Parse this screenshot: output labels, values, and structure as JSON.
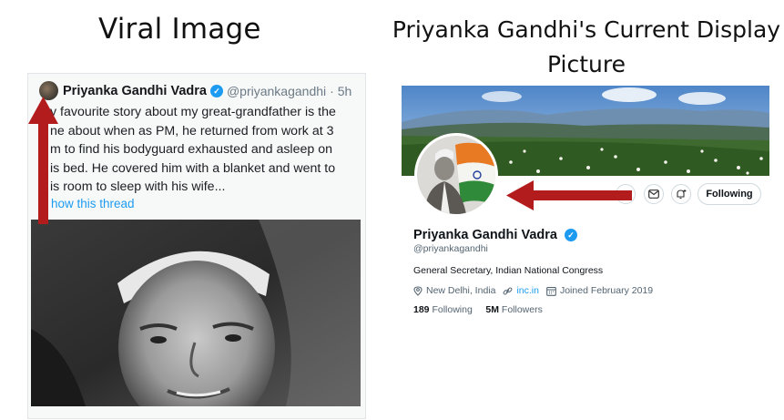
{
  "captions": {
    "left": "Viral Image",
    "right": "Priyanka Gandhi's Current Display Picture"
  },
  "viral_tweet": {
    "author_name": "Priyanka Gandhi Vadra",
    "handle": "@priyankagandhi",
    "time": "· 5h",
    "text": "y favourite story about my great-grandfather is the\nne about when as PM, he returned from work at 3\nm to find his bodyguard exhausted and asleep on\nis bed. He covered him with a blanket and went to\nis room to sleep with his wife...",
    "thread_link": "how this thread",
    "verified_glyph": "✓"
  },
  "profile": {
    "name": "Priyanka Gandhi Vadra",
    "handle": "@priyankagandhi",
    "bio": "General Secretary, Indian National Congress",
    "location": "New Delhi, India",
    "website": "inc.in",
    "joined": "Joined February 2019",
    "following_count": "189",
    "following_label": "Following",
    "followers_count": "5M",
    "followers_label": "Followers",
    "follow_button": "Following",
    "more_glyph": "···",
    "verified_glyph": "✓"
  },
  "colors": {
    "twitter_blue": "#1d9bf0",
    "arrow_red": "#b31c1c"
  },
  "icons": [
    "verified-icon",
    "more-icon",
    "mail-icon",
    "notify-icon",
    "location-icon",
    "link-icon",
    "calendar-icon"
  ]
}
